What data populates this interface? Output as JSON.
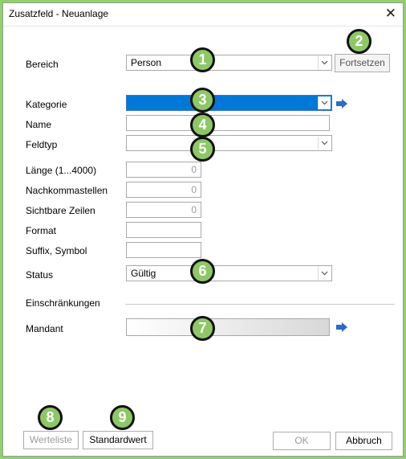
{
  "window": {
    "title": "Zusatzfeld - Neuanlage",
    "close_glyph": "✕"
  },
  "fields": {
    "bereich": {
      "label": "Bereich",
      "value": "Person"
    },
    "fortsetzen_label": "Fortsetzen",
    "kategorie": {
      "label": "Kategorie",
      "value": ""
    },
    "name": {
      "label": "Name",
      "value": ""
    },
    "feldtyp": {
      "label": "Feldtyp",
      "value": ""
    },
    "laenge": {
      "label": "Länge (1...4000)",
      "value": "0"
    },
    "nachkommastellen": {
      "label": "Nachkommastellen",
      "value": "0"
    },
    "sichtbare_zeilen": {
      "label": "Sichtbare Zeilen",
      "value": "0"
    },
    "format": {
      "label": "Format",
      "value": ""
    },
    "suffix": {
      "label": "Suffix, Symbol",
      "value": ""
    },
    "status": {
      "label": "Status",
      "value": "Gültig"
    }
  },
  "section": {
    "einschraenkungen": "Einschränkungen"
  },
  "mandant": {
    "label": "Mandant",
    "value": ""
  },
  "footer": {
    "werteliste": "Werteliste",
    "standardwert": "Standardwert",
    "ok": "OK",
    "abbruch": "Abbruch"
  },
  "callouts": [
    "1",
    "2",
    "3",
    "4",
    "5",
    "6",
    "7",
    "8",
    "9"
  ],
  "colors": {
    "callout": "#8dc865",
    "selection": "#0078d7",
    "link_arrow": "#2b6cc4",
    "frame": "#8fd16a"
  },
  "icons": {
    "dropdown": "chevron-down-icon",
    "link": "link-arrow-icon",
    "close": "close-icon"
  }
}
